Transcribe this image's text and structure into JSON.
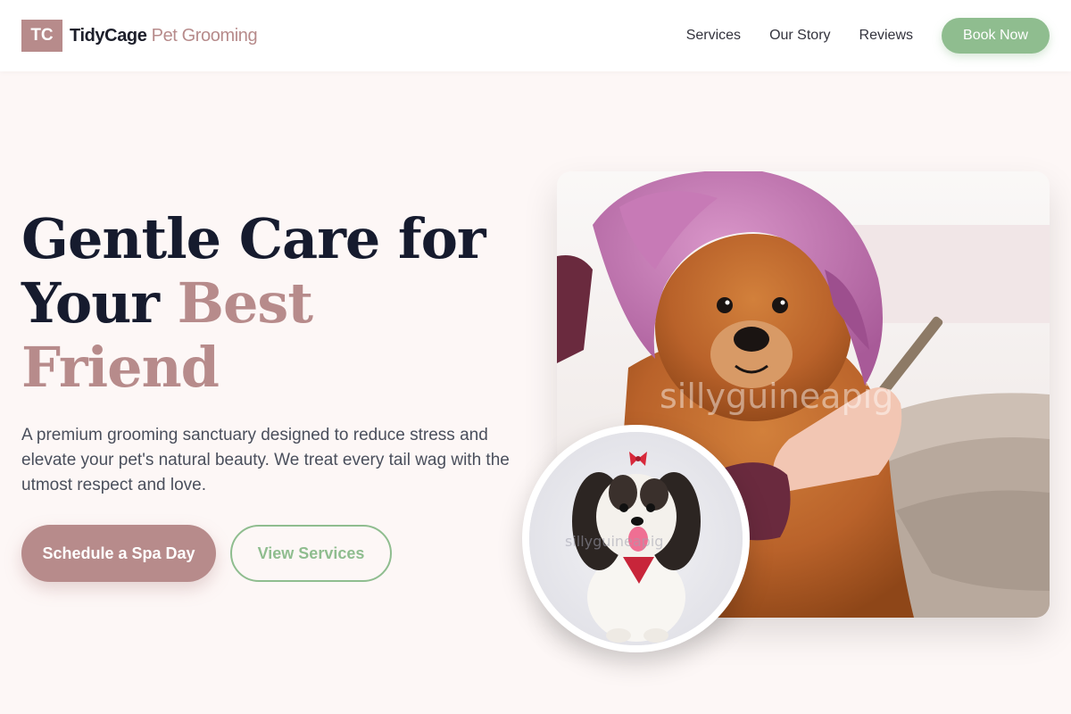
{
  "header": {
    "logo_mark": "TC",
    "brand_primary": "TidyCage",
    "brand_secondary": "Pet Grooming",
    "nav": [
      {
        "label": "Services"
      },
      {
        "label": "Our Story"
      },
      {
        "label": "Reviews"
      }
    ],
    "cta_label": "Book Now"
  },
  "hero": {
    "title_line1": "Gentle Care for",
    "title_line2_start": "Your ",
    "title_accent": "Best Friend",
    "description": "A premium grooming sanctuary designed to reduce stress and elevate your pet's natural beauty. We treat every tail wag with the utmost respect and love.",
    "primary_button": "Schedule a Spa Day",
    "secondary_button": "View Services",
    "main_image_watermark": "sillyguineapig",
    "round_image_watermark": "sillyguineapig"
  },
  "colors": {
    "accent_rose": "#b78b8b",
    "accent_green": "#8fbd8f",
    "title_dark": "#161b2e",
    "page_bg": "#fdf7f6"
  },
  "images": {
    "main": "pomeranian-in-pink-towel-being-combed",
    "inset": "shih-tzu-with-red-bow"
  }
}
